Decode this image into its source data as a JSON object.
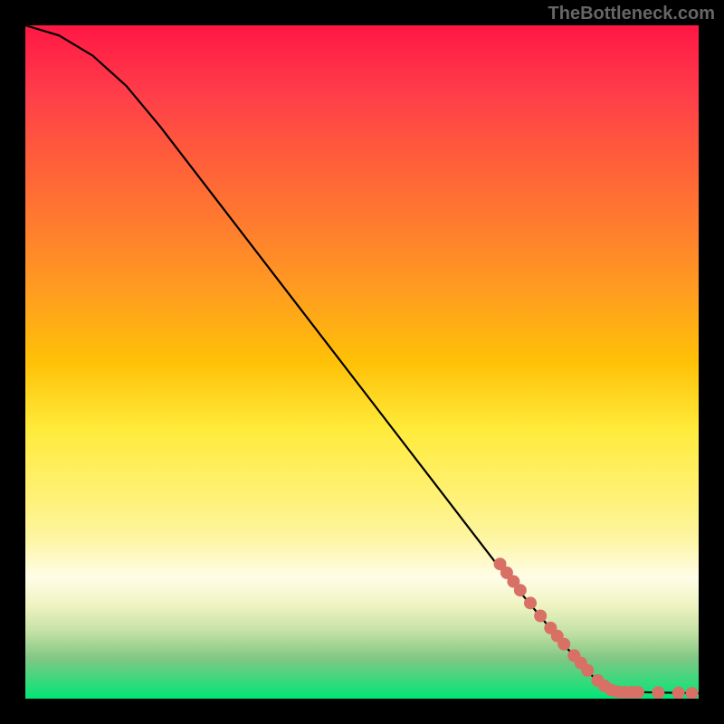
{
  "watermark": "TheBottleneck.com",
  "chart_data": {
    "type": "line",
    "title": "",
    "xlabel": "",
    "ylabel": "",
    "xlim": [
      0,
      100
    ],
    "ylim": [
      0,
      100
    ],
    "curve": [
      {
        "x": 0,
        "y": 100
      },
      {
        "x": 5,
        "y": 98.5
      },
      {
        "x": 10,
        "y": 95.5
      },
      {
        "x": 15,
        "y": 91
      },
      {
        "x": 20,
        "y": 85
      },
      {
        "x": 30,
        "y": 72
      },
      {
        "x": 40,
        "y": 59
      },
      {
        "x": 50,
        "y": 46
      },
      {
        "x": 60,
        "y": 33
      },
      {
        "x": 70,
        "y": 20
      },
      {
        "x": 75,
        "y": 14
      },
      {
        "x": 80,
        "y": 8
      },
      {
        "x": 85,
        "y": 2.5
      },
      {
        "x": 87,
        "y": 1.2
      },
      {
        "x": 89,
        "y": 0.95
      },
      {
        "x": 92,
        "y": 0.95
      },
      {
        "x": 100,
        "y": 0.8
      }
    ],
    "markers": [
      {
        "x": 70.5,
        "y": 20.0
      },
      {
        "x": 71.5,
        "y": 18.7
      },
      {
        "x": 72.5,
        "y": 17.4
      },
      {
        "x": 73.5,
        "y": 16.1
      },
      {
        "x": 75.0,
        "y": 14.2
      },
      {
        "x": 76.5,
        "y": 12.3
      },
      {
        "x": 78.0,
        "y": 10.5
      },
      {
        "x": 79.0,
        "y": 9.3
      },
      {
        "x": 80.0,
        "y": 8.1
      },
      {
        "x": 81.5,
        "y": 6.4
      },
      {
        "x": 82.5,
        "y": 5.3
      },
      {
        "x": 83.5,
        "y": 4.2
      },
      {
        "x": 85.0,
        "y": 2.7
      },
      {
        "x": 86.0,
        "y": 1.9
      },
      {
        "x": 87.0,
        "y": 1.3
      },
      {
        "x": 88.0,
        "y": 1.0
      },
      {
        "x": 89.0,
        "y": 0.95
      },
      {
        "x": 90.0,
        "y": 0.95
      },
      {
        "x": 91.0,
        "y": 0.95
      },
      {
        "x": 94.0,
        "y": 0.9
      },
      {
        "x": 97.0,
        "y": 0.85
      },
      {
        "x": 99.0,
        "y": 0.8
      }
    ],
    "marker_color": "#d87066",
    "curve_color": "#000000"
  }
}
